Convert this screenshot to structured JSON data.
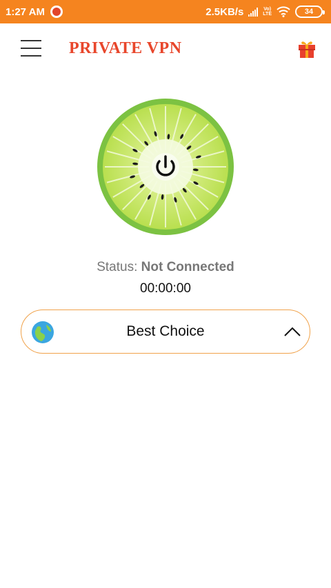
{
  "status_bar": {
    "time": "1:27 AM",
    "network_speed": "2.5KB/s",
    "volte_top": "Vo)",
    "volte_bottom": "LTE",
    "battery": "34",
    "app_icon": "shield-app-icon",
    "signal_icon": "cellular-signal-icon",
    "wifi_icon": "wifi-icon"
  },
  "header": {
    "menu_icon": "hamburger-menu-icon",
    "title": "PRIVATE VPN",
    "gift_icon": "gift-icon"
  },
  "connect": {
    "icon": "kiwi-power-button-icon"
  },
  "status": {
    "label": "Status:",
    "value": "Not Connected",
    "timer": "00:00:00"
  },
  "server": {
    "label": "Best Choice",
    "icon": "globe-icon",
    "chevron": "chevron-up-icon"
  },
  "colors": {
    "status_bar": "#f5841f",
    "brand": "#e8462b",
    "kiwi_rim": "#7cc242",
    "selector_border": "#f0a24a"
  }
}
